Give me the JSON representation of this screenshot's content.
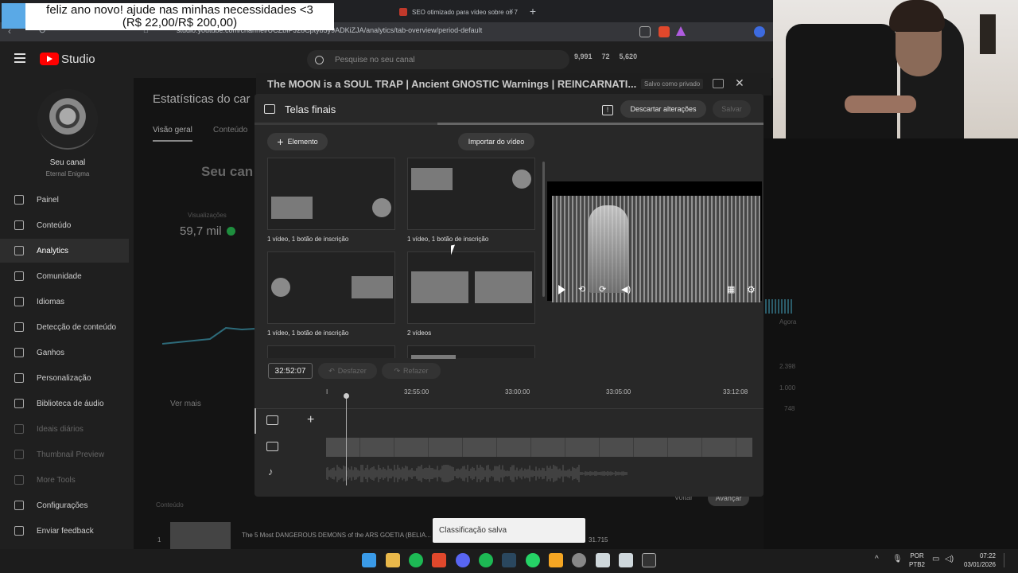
{
  "banner": {
    "line1": "feliz ano novo! ajude nas minhas necessidades <3",
    "line2": "(R$ 22,00/R$ 200,00)"
  },
  "browser": {
    "tab2_label": "SEO otimizado para vídeo sobre os 7",
    "tab2_close": "×",
    "new_tab": "+",
    "url": "studio.youtube.com/channel/UCZbIPJ28Cptyb5y9ADKiZJA/analytics/tab-overview/period-default"
  },
  "header": {
    "app_name": "Studio",
    "search_placeholder": "Pesquise no seu canal",
    "stat1": "9,991",
    "stat2": "72",
    "stat3": "5,620"
  },
  "sidebar": {
    "channel_name": "Seu canal",
    "channel_sub": "Eternal Enigma",
    "items": [
      {
        "label": "Painel",
        "icon": "dashboard-icon"
      },
      {
        "label": "Conteúdo",
        "icon": "content-icon"
      },
      {
        "label": "Analytics",
        "icon": "analytics-icon",
        "active": true
      },
      {
        "label": "Comunidade",
        "icon": "community-icon"
      },
      {
        "label": "Idiomas",
        "icon": "subtitles-icon"
      },
      {
        "label": "Detecção de conteúdo",
        "icon": "copyright-icon"
      },
      {
        "label": "Ganhos",
        "icon": "dollar-icon"
      },
      {
        "label": "Personalização",
        "icon": "wand-icon"
      },
      {
        "label": "Biblioteca de áudio",
        "icon": "audio-library-icon"
      },
      {
        "label": "Ideais diários",
        "icon": "ideas-icon",
        "dim": true
      },
      {
        "label": "Thumbnail Preview",
        "icon": "thumbnail-icon",
        "dim": true
      },
      {
        "label": "More Tools",
        "icon": "tools-icon",
        "dim": true
      },
      {
        "label": "Configurações",
        "icon": "gear-icon"
      },
      {
        "label": "Enviar feedback",
        "icon": "feedback-icon"
      }
    ]
  },
  "background_page": {
    "title": "Estatísticas do car",
    "tab_overview": "Visão geral",
    "tab_content": "Conteúdo",
    "seu_canal": "Seu can",
    "views_label": "Visualizações",
    "views_value": "59,7 mil",
    "see_more": "Ver mais",
    "right_label_now": "Agora",
    "right_v1": "2.398",
    "right_v2": "1.000",
    "right_v3": "748",
    "row_title": "The 5 Most DANGEROUS DEMONS of the ARS GOETIA (BELIA...",
    "row_num": "1",
    "row_value": "31.715",
    "content_header": "Conteúdo",
    "btn_voltar": "Voltar",
    "btn_avancar": "Avançar"
  },
  "video_bar": {
    "title": "The MOON is a SOUL TRAP | Ancient GNOSTIC Warnings | REINCARNATI...",
    "saved_status": "Salvo como privado",
    "close": "✕"
  },
  "editor": {
    "title": "Telas finais",
    "discard": "Descartar alterações",
    "save": "Salvar",
    "element_button": "Elemento",
    "import_button": "Importar do vídeo",
    "templates": [
      {
        "label": "1 vídeo, 1 botão de inscrição"
      },
      {
        "label": "1 vídeo, 1 botão de inscrição"
      },
      {
        "label": "1 vídeo, 1 botão de inscrição"
      },
      {
        "label": "2 vídeos"
      }
    ],
    "timecode": "32:52:07",
    "undo": "Desfazer",
    "redo": "Refazer",
    "ruler": {
      "start": "I",
      "t1": "32:55:00",
      "t2": "33:00:00",
      "t3": "33:05:00",
      "t4": "33:12:08"
    }
  },
  "toast": "Classificação salva",
  "taskbar": {
    "lang1": "POR",
    "lang2": "PTB2",
    "time": "07:22",
    "date": "03/01/2026"
  }
}
